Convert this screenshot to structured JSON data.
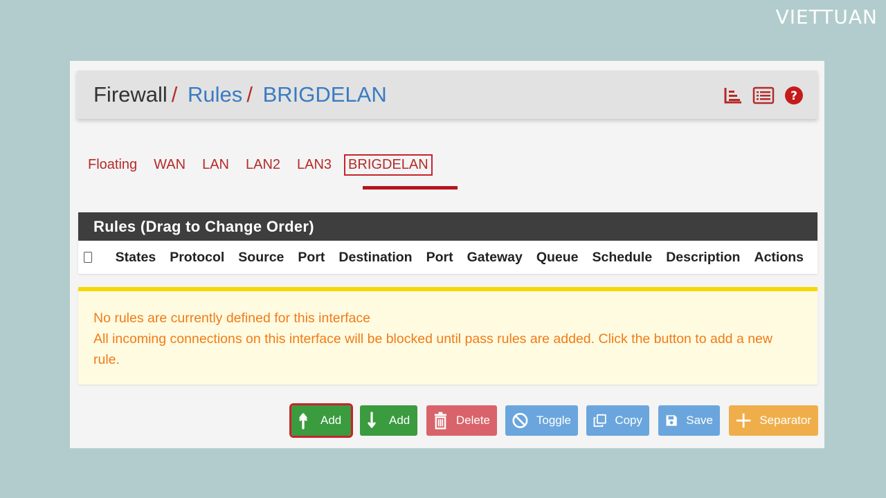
{
  "brand": {
    "logo_text": "VIETTUAN"
  },
  "header": {
    "crumb_firewall": "Firewall",
    "crumb_rules": "Rules",
    "crumb_interface": "BRIGDELAN",
    "separator": "/",
    "icons": [
      "chart-icon",
      "list-icon",
      "help-icon"
    ]
  },
  "tabs": [
    {
      "label": "Floating"
    },
    {
      "label": "WAN"
    },
    {
      "label": "LAN"
    },
    {
      "label": "LAN2"
    },
    {
      "label": "LAN3"
    },
    {
      "label": "BRIGDELAN",
      "active": true
    }
  ],
  "table": {
    "title": "Rules (Drag to Change Order)",
    "columns": [
      "States",
      "Protocol",
      "Source",
      "Port",
      "Destination",
      "Port",
      "Gateway",
      "Queue",
      "Schedule",
      "Description",
      "Actions"
    ]
  },
  "notice": {
    "line1": "No rules are currently defined for this interface",
    "line2": "All incoming connections on this interface will be blocked until pass rules are added. Click the button to add a new rule."
  },
  "buttons": {
    "add_top": "Add",
    "add_bottom": "Add",
    "delete": "Delete",
    "toggle": "Toggle",
    "copy": "Copy",
    "save": "Save",
    "separator": "Separator"
  },
  "colors": {
    "accent_red": "#b52a2a",
    "link_blue": "#3a7bc2",
    "notice_text": "#f07b18",
    "notice_border": "#f6d800"
  }
}
